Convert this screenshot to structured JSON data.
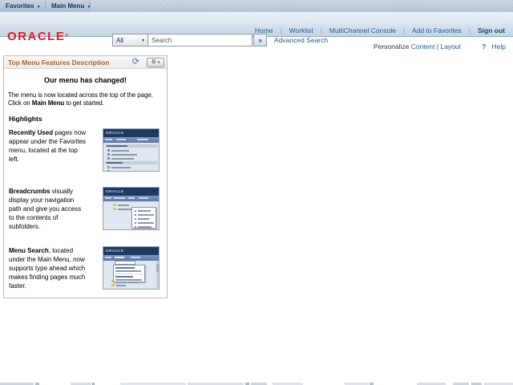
{
  "icons": {
    "caret_down": "▾",
    "refresh": "⟳",
    "gear": "⚙",
    "go": "»",
    "help_glyph": "?"
  },
  "colors": {
    "link_blue": "#1d5b99",
    "brand_red": "#e0201f",
    "pagelet_title_brown": "#a8622f",
    "topbar_blue": "#b7c6d9"
  },
  "topbar": {
    "favorites": "Favorites",
    "main_menu": "Main Menu"
  },
  "header": {
    "brand": "ORACLE",
    "brand_mark": "®",
    "links": {
      "home": "Home",
      "worklist": "Worklist",
      "multichannel": "MultiChannel Console",
      "add_to_favorites": "Add to Favorites",
      "sign_out": "Sign out",
      "separator": "|"
    },
    "search": {
      "scope": "All",
      "placeholder": "Search",
      "advanced": "Advanced Search"
    }
  },
  "personalize": {
    "label": "Personalize",
    "content": "Content",
    "divider": "|",
    "layout": "Layout",
    "help": "Help"
  },
  "pagelet": {
    "title": "Top Menu Features Description",
    "announcement": "Our menu has changed!",
    "intro_line1": "The menu is now located across the top of the page.",
    "intro_line2_pre": "Click on ",
    "intro_line2_bold": "Main Menu",
    "intro_line2_post": " to get started.",
    "highlights_heading": "Highlights",
    "highlights": [
      {
        "lead": "Recently Used",
        "text": " pages now appear under the Favorites menu, located at the top left."
      },
      {
        "lead": "Breadcrumbs",
        "text": " visually display your navigation path and give you access to the contents of subfolders."
      },
      {
        "lead": "Menu Search",
        "text": ", located under the Main Menu, now supports type ahead which makes finding pages much faster."
      }
    ],
    "mini_brand": "ORACLE"
  }
}
